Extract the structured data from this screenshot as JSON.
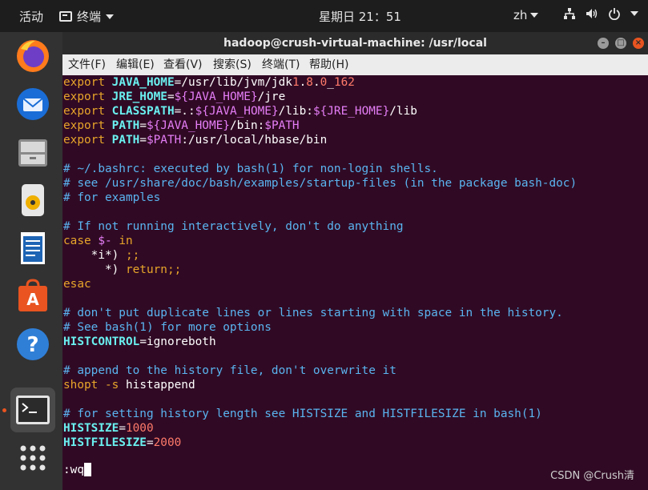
{
  "topbar": {
    "activities": "活动",
    "app_menu_label": "终端",
    "clock": "星期日 21：51",
    "lang": "zh"
  },
  "window": {
    "title": "hadoop@crush-virtual-machine: /usr/local"
  },
  "menubar": {
    "items": [
      "文件(F)",
      "编辑(E)",
      "查看(V)",
      "搜索(S)",
      "终端(T)",
      "帮助(H)"
    ]
  },
  "terminal": {
    "lines": [
      "export JAVA_HOME=/usr/lib/jvm/jdk1.8.0_162",
      "export JRE_HOME=${JAVA_HOME}/jre",
      "export CLASSPATH=.:${JAVA_HOME}/lib:${JRE_HOME}/lib",
      "export PATH=${JAVA_HOME}/bin:$PATH",
      "export PATH=$PATH:/usr/local/hbase/bin",
      "",
      "# ~/.bashrc: executed by bash(1) for non-login shells.",
      "# see /usr/share/doc/bash/examples/startup-files (in the package bash-doc)",
      "# for examples",
      "",
      "# If not running interactively, don't do anything",
      "case $- in",
      "    *i*) ;;",
      "      *) return;;",
      "esac",
      "",
      "# don't put duplicate lines or lines starting with space in the history.",
      "# See bash(1) for more options",
      "HISTCONTROL=ignoreboth",
      "",
      "# append to the history file, don't overwrite it",
      "shopt -s histappend",
      "",
      "# for setting history length see HISTSIZE and HISTFILESIZE in bash(1)",
      "HISTSIZE=1000",
      "HISTFILESIZE=2000",
      ""
    ],
    "command_line": ":wq"
  },
  "dock": {
    "items": [
      "firefox-icon",
      "thunderbird-icon",
      "files-icon",
      "rhythmbox-icon",
      "libreoffice-writer-icon",
      "software-center-icon",
      "help-icon",
      "terminal-icon",
      "show-apps-icon"
    ]
  },
  "watermark": "CSDN @Crush清",
  "colors": {
    "terminal_bg": "#300a24",
    "accent": "#e95420",
    "keyword": "#5de0e6",
    "comment": "#5ab4f0",
    "number": "#ff7a6a",
    "string": "#e57ef7"
  }
}
